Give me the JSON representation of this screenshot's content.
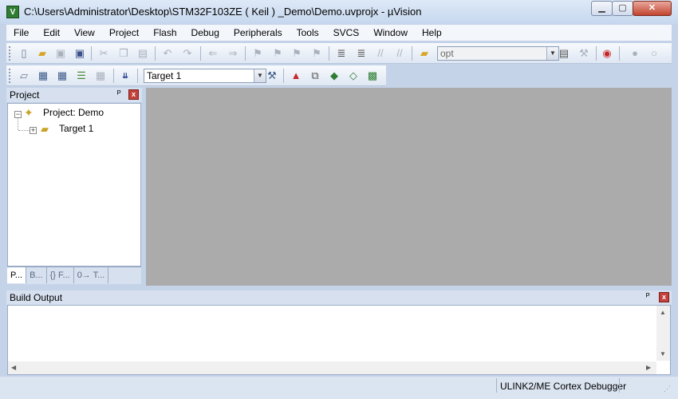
{
  "window": {
    "title": "C:\\Users\\Administrator\\Desktop\\STM32F103ZE ( Keil ) _Demo\\Demo.uvprojx - µVision",
    "app_icon_label": "V",
    "min_label": "▁",
    "max_label": "▢",
    "close_label": "✕"
  },
  "menu": [
    "File",
    "Edit",
    "View",
    "Project",
    "Flash",
    "Debug",
    "Peripherals",
    "Tools",
    "SVCS",
    "Window",
    "Help"
  ],
  "toolbar1": {
    "icons": [
      "new-file-icon",
      "open-folder-icon",
      "save-icon",
      "save-all-icon",
      "cut-icon",
      "copy-icon",
      "paste-icon",
      "undo-icon",
      "redo-icon",
      "nav-back-icon",
      "nav-forward-icon",
      "bookmark-insert-icon",
      "bookmark-prev-icon",
      "bookmark-next-icon",
      "bookmark-clear-icon",
      "indent-icon",
      "unindent-icon",
      "comment-icon",
      "uncomment-icon",
      "find-in-files-icon",
      "debug-icon",
      "breakpoint-icon",
      "breakpoint-disabled-icon"
    ],
    "find_combo_value": "opt"
  },
  "toolbar2": {
    "target_combo_value": "Target 1"
  },
  "project_panel": {
    "title": "Project",
    "pin": "ᴾ",
    "close": "x",
    "root_label": "Project: Demo",
    "target_label": "Target 1",
    "tabs": [
      "P...",
      "B...",
      "{} F...",
      "0→ T..."
    ]
  },
  "build_output": {
    "title": "Build Output",
    "pin": "ᴾ",
    "close": "x"
  },
  "status": {
    "debugger": "ULINK2/ME Cortex Debugger"
  }
}
